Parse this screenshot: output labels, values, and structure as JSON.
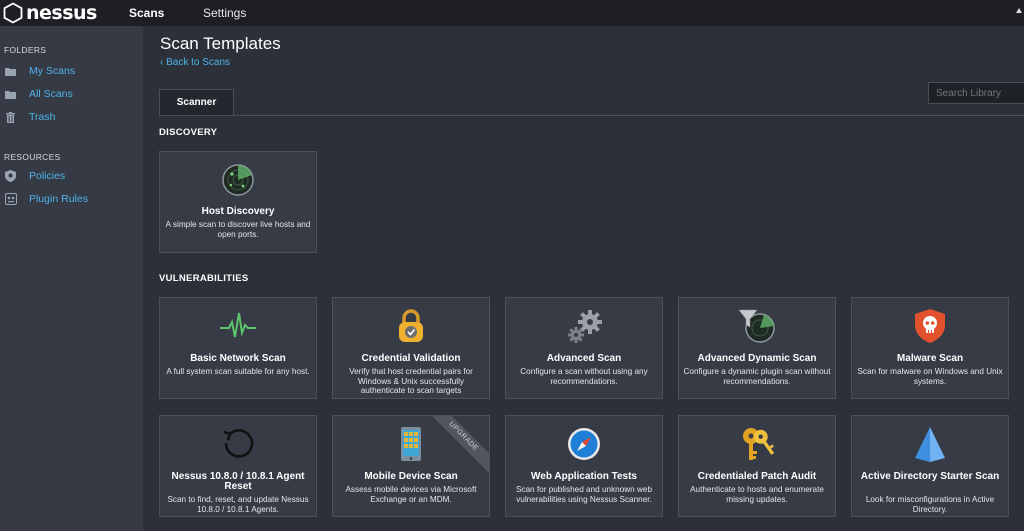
{
  "nav": {
    "brand": "nessus",
    "scans": "Scans",
    "settings": "Settings"
  },
  "sidebar": {
    "folders_title": "FOLDERS",
    "folders": [
      {
        "label": "My Scans",
        "icon": "folder-icon"
      },
      {
        "label": "All Scans",
        "icon": "folder-icon"
      },
      {
        "label": "Trash",
        "icon": "trash-icon"
      }
    ],
    "resources_title": "RESOURCES",
    "resources": [
      {
        "label": "Policies",
        "icon": "shield-icon"
      },
      {
        "label": "Plugin Rules",
        "icon": "plugin-rules-icon"
      }
    ]
  },
  "main": {
    "title": "Scan Templates",
    "back": "Back to Scans",
    "tab": "Scanner",
    "search_placeholder": "Search Library",
    "discovery_title": "DISCOVERY",
    "vulnerabilities_title": "VULNERABILITIES",
    "discovery": [
      {
        "title": "Host Discovery",
        "desc": "A simple scan to discover live hosts and open ports.",
        "icon": "radar-icon"
      }
    ],
    "vulnerabilities": [
      {
        "title": "Basic Network Scan",
        "desc": "A full system scan suitable for any host.",
        "icon": "pulse-icon"
      },
      {
        "title": "Credential Validation",
        "desc": "Verify that host credential pairs for Windows & Unix successfully authenticate to scan targets",
        "icon": "padlock-check-icon"
      },
      {
        "title": "Advanced Scan",
        "desc": "Configure a scan without using any recommendations.",
        "icon": "gears-icon"
      },
      {
        "title": "Advanced Dynamic Scan",
        "desc": "Configure a dynamic plugin scan without recommendations.",
        "icon": "filter-radar-icon"
      },
      {
        "title": "Malware Scan",
        "desc": "Scan for malware on Windows and Unix systems.",
        "icon": "skull-shield-icon"
      },
      {
        "title": "Nessus 10.8.0 / 10.8.1 Agent Reset",
        "desc": "Scan to find, reset, and update Nessus 10.8.0 / 10.8.1 Agents.",
        "icon": "reset-icon"
      },
      {
        "title": "Mobile Device Scan",
        "desc": "Assess mobile devices via Microsoft Exchange or an MDM.",
        "icon": "mobile-device-icon",
        "ribbon": "UPGRADE"
      },
      {
        "title": "Web Application Tests",
        "desc": "Scan for published and unknown web vulnerabilities using Nessus Scanner.",
        "icon": "compass-icon"
      },
      {
        "title": "Credentialed Patch Audit",
        "desc": "Authenticate to hosts and enumerate missing updates.",
        "icon": "keys-icon"
      },
      {
        "title": "Active Directory Starter Scan",
        "desc": "Look for misconfigurations in Active Directory.",
        "icon": "pyramid-icon"
      }
    ]
  },
  "colors": {
    "accent": "#4fb3ea",
    "topbar": "#1d1f25",
    "sidebar": "#353a44",
    "card": "#363b45"
  }
}
